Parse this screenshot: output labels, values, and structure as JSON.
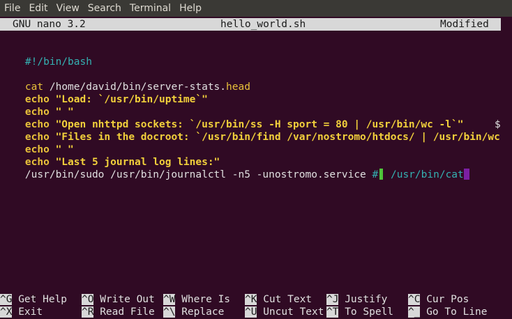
{
  "menu": {
    "items": [
      "File",
      "Edit",
      "View",
      "Search",
      "Terminal",
      "Help"
    ]
  },
  "nano": {
    "version": "GNU nano 3.2",
    "filename": "hello_world.sh",
    "status": "Modified"
  },
  "editor": {
    "line1": "#!/bin/bash",
    "line2_kw": "cat",
    "line2_path": " /home/david/bin/server-stats.",
    "line2_ext": "head",
    "line3_kw": "echo",
    "line3_str": " \"Load: `/usr/bin/uptime`\"",
    "line4_kw": "echo",
    "line4_str": " \" \"",
    "line5_kw": "echo",
    "line5_str": " \"Open nhttpd sockets: `/usr/bin/ss -H sport = 80 | /usr/bin/wc -l`\"",
    "line6_kw": "echo",
    "line6_str": " \"Files in the docroot: `/usr/bin/find /var/nostromo/htdocs/ | /usr/bin/wc",
    "line6_marker": "$",
    "line7_kw": "echo",
    "line7_str": " \" \"",
    "line8_kw": "echo",
    "line8_str": " \"Last 5 journal log lines:\"",
    "line9_cmd": "/usr/bin/sudo /usr/bin/journalctl -n5 -unostromo.service ",
    "line9_hash": "#",
    "line9_tail": " /usr/bin/cat"
  },
  "shortcuts": {
    "row1": [
      {
        "key": "^G",
        "label": "Get Help"
      },
      {
        "key": "^O",
        "label": "Write Out"
      },
      {
        "key": "^W",
        "label": "Where Is"
      },
      {
        "key": "^K",
        "label": "Cut Text"
      },
      {
        "key": "^J",
        "label": "Justify"
      },
      {
        "key": "^C",
        "label": "Cur Pos"
      }
    ],
    "row2": [
      {
        "key": "^X",
        "label": "Exit"
      },
      {
        "key": "^R",
        "label": "Read File"
      },
      {
        "key": "^\\",
        "label": "Replace"
      },
      {
        "key": "^U",
        "label": "Uncut Text"
      },
      {
        "key": "^T",
        "label": "To Spell"
      },
      {
        "key": "^_",
        "label": "Go To Line"
      }
    ]
  }
}
